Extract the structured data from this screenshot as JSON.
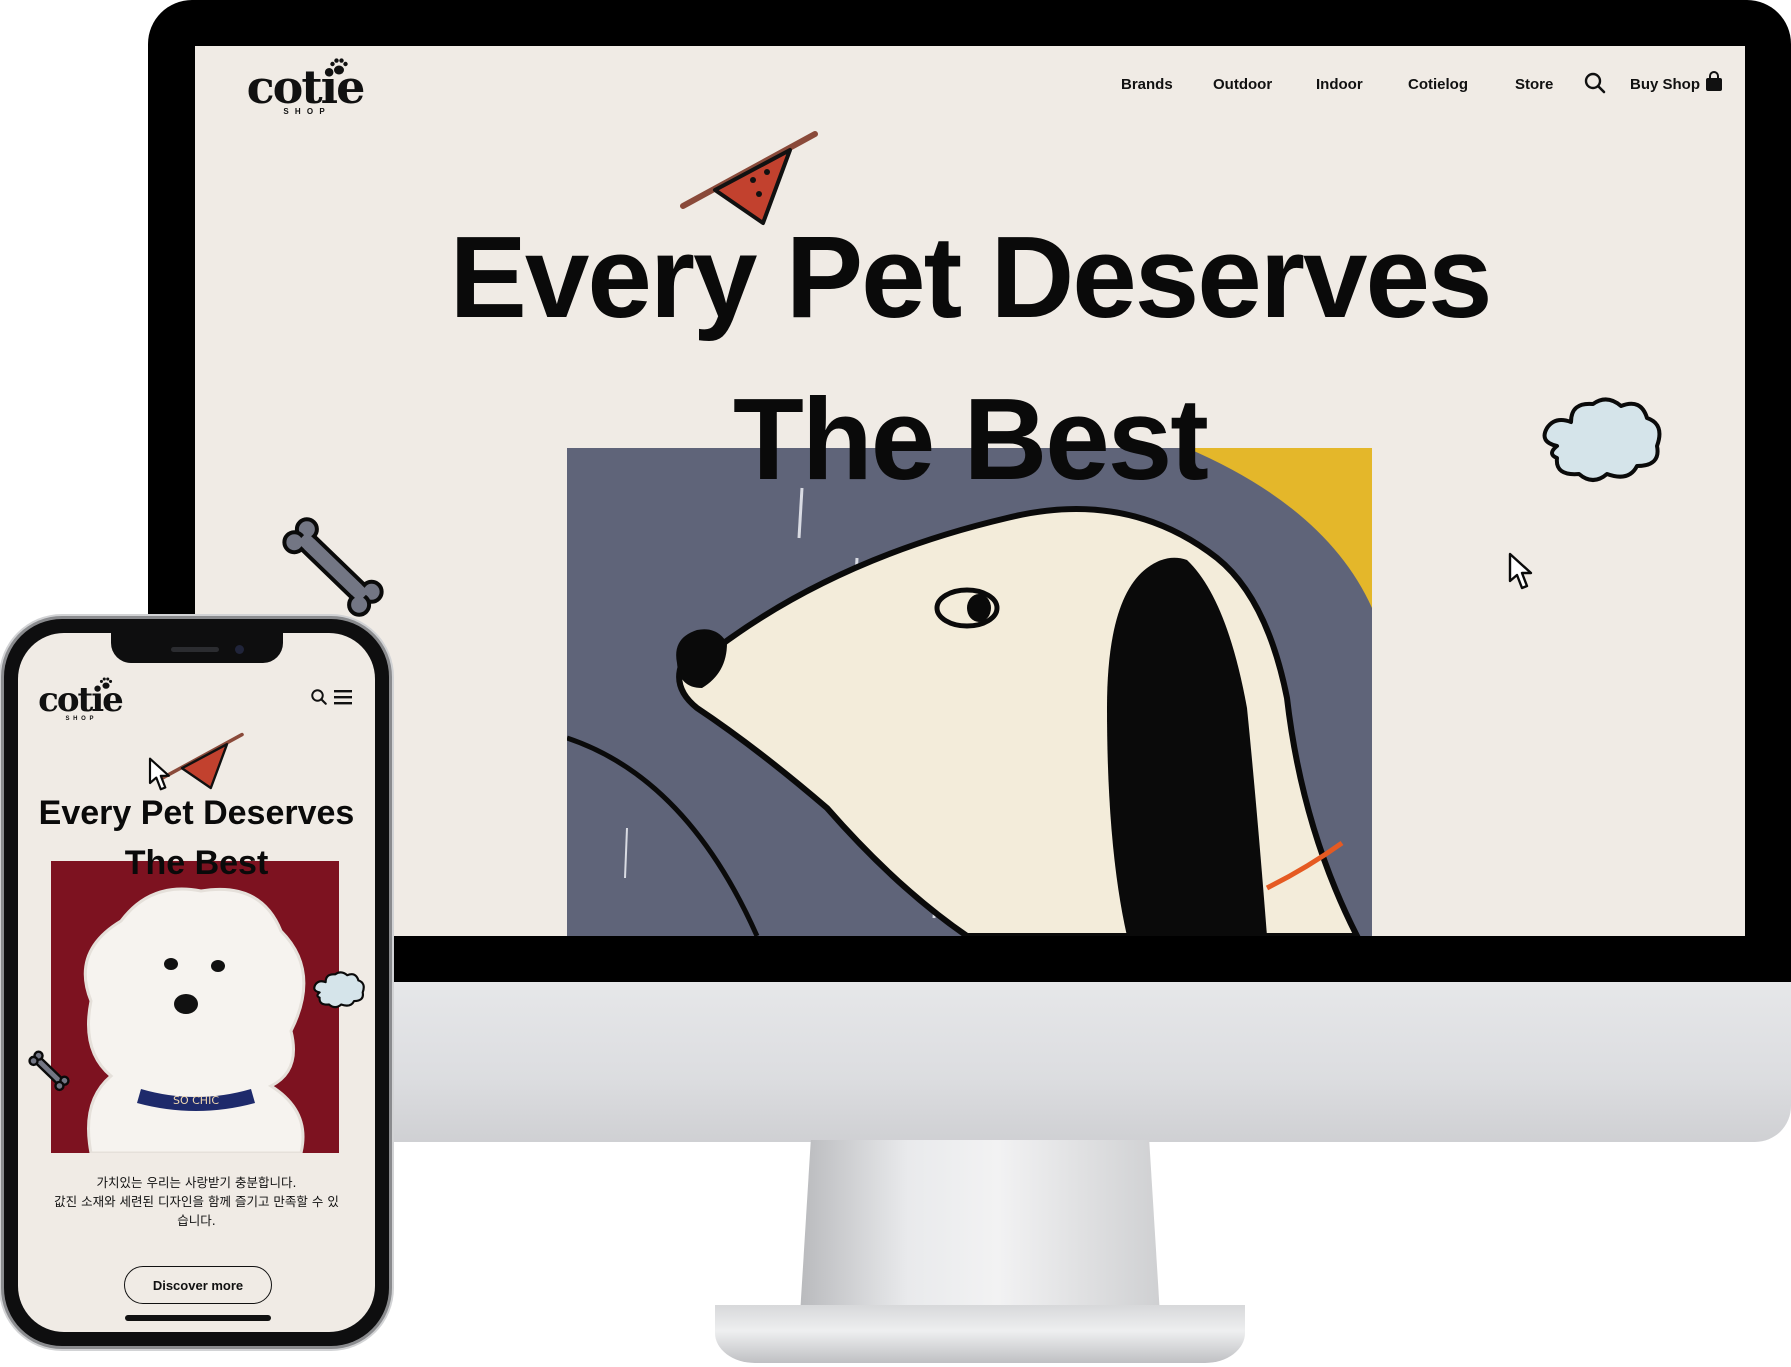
{
  "desktop": {
    "logo": {
      "word": "cotie",
      "sub": "S H O P"
    },
    "nav": {
      "items": [
        "Brands",
        "Outdoor",
        "Indoor",
        "Cotielog",
        "Store"
      ],
      "buy_label": "Buy Shop"
    },
    "hero": {
      "line1": "Every Pet Deserves",
      "line2": "The Best"
    }
  },
  "mobile": {
    "logo": {
      "word": "cotie",
      "sub": "S H O P"
    },
    "hero": {
      "line1": "Every Pet Deserves",
      "line2": "The Best"
    },
    "collar_text": "SO CHIC",
    "description": {
      "line1": "가치있는 우리는 사랑받기 충분합니다.",
      "line2": "값진 소재와 세련된 디자인을 함께 즐기고 만족할 수 있",
      "line3": "습니다."
    },
    "cta_label": "Discover more"
  },
  "colors": {
    "background": "#f0ebe5",
    "text": "#0a0a0a",
    "painting_bg": "#5f6479",
    "painting_accent": "#e4b72a",
    "poodle_bg": "#7d1220",
    "cloud": "#d5e4ea"
  },
  "icons": [
    "paw-icon",
    "search-icon",
    "shopping-bag-icon",
    "menu-icon",
    "cursor-icon",
    "cloud-icon",
    "bone-icon",
    "bandana-icon"
  ]
}
